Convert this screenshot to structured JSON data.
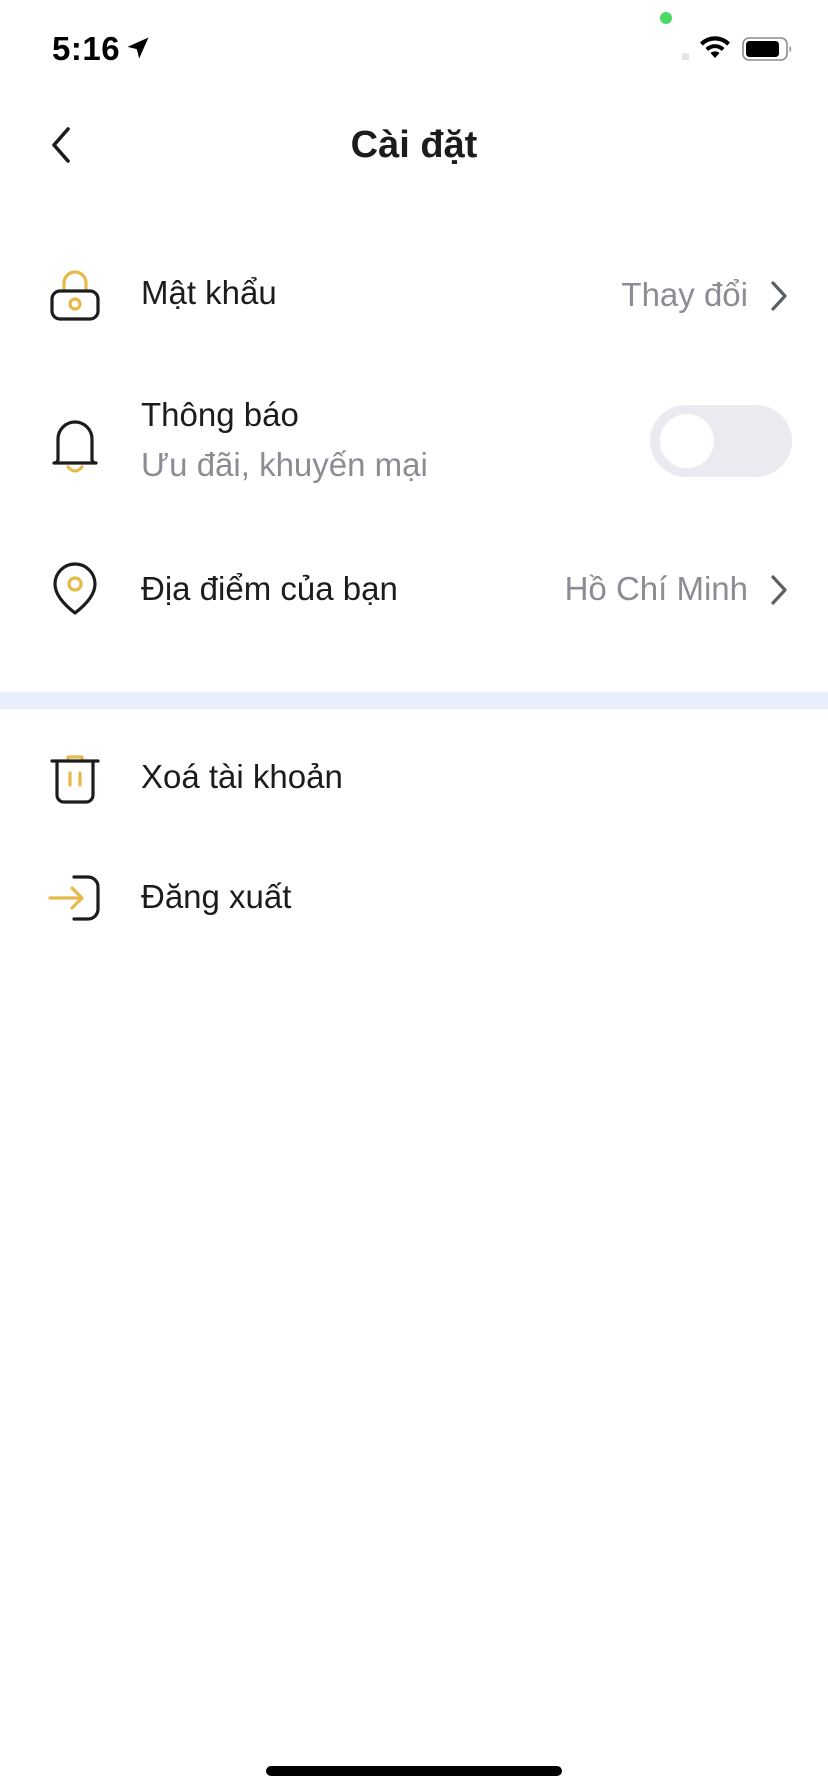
{
  "status_bar": {
    "time": "5:16",
    "icons": [
      "location-arrow-icon",
      "wifi-icon",
      "battery-icon"
    ]
  },
  "header": {
    "title": "Cài đặt",
    "back_icon": "chevron-left-icon"
  },
  "settings": {
    "password": {
      "label": "Mật khẩu",
      "value": "Thay đổi",
      "icon": "lock-icon"
    },
    "notifications": {
      "label": "Thông báo",
      "sublabel": "Ưu đãi, khuyến mại",
      "icon": "bell-icon",
      "enabled": false
    },
    "location": {
      "label": "Địa điểm của bạn",
      "value": "Hồ Chí Minh",
      "icon": "location-pin-icon"
    }
  },
  "account": {
    "delete": {
      "label": "Xoá tài khoản",
      "icon": "trash-icon"
    },
    "logout": {
      "label": "Đăng xuất",
      "icon": "logout-icon"
    }
  },
  "colors": {
    "accent": "#e8b84a",
    "icon_stroke": "#1c1c1e",
    "muted_text": "#8a8d93",
    "divider": "#eaeefc",
    "toggle_off": "#e9ebf0"
  }
}
